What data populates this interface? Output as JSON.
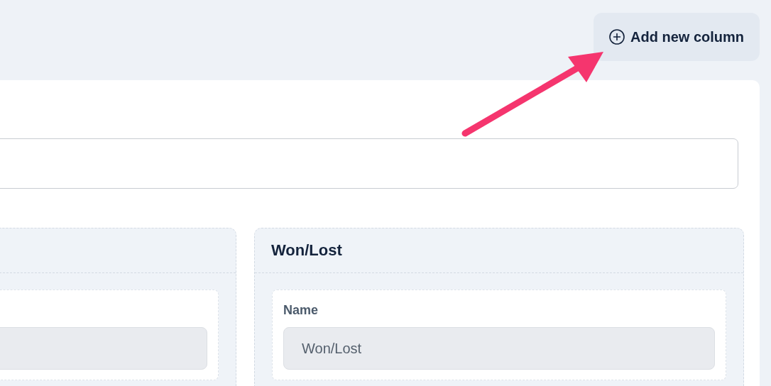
{
  "add_column_button": {
    "label": "Add new column"
  },
  "columns": [
    {
      "kind": "partial"
    },
    {
      "kind": "full",
      "title": "Won/Lost",
      "name_label": "Name",
      "name_value": "Won/Lost"
    }
  ]
}
